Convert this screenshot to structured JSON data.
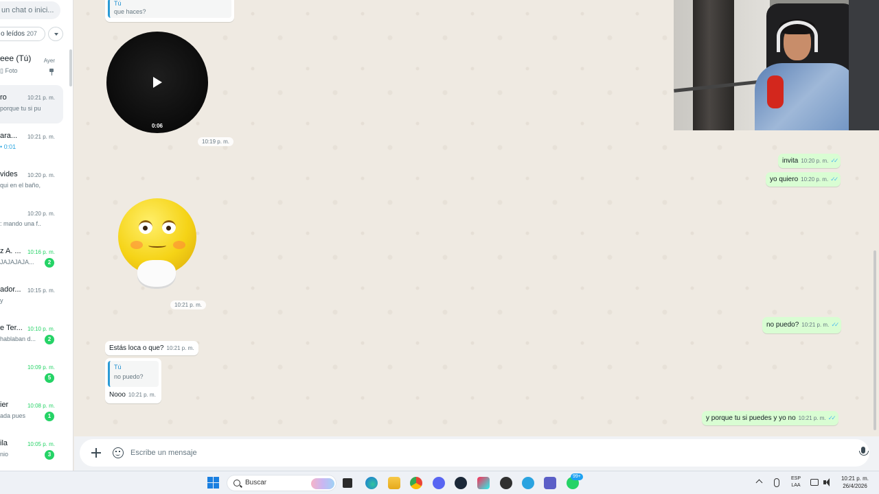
{
  "sidebar": {
    "search_text": "un chat o inici...",
    "filter_label": "o leídos",
    "filter_count": "207",
    "chats": [
      {
        "name": "eee (Tú)",
        "time": "Ayer",
        "preview": "Foto",
        "badge": "",
        "pinned": true
      },
      {
        "name": "ro",
        "time": "10:21 p. m.",
        "preview": "porque tu si pu...",
        "badge": ""
      },
      {
        "name": "ara...",
        "time": "10:21 p. m.",
        "preview": "0:01",
        "badge": ""
      },
      {
        "name": "vides",
        "time": "10:20 p. m.",
        "preview": "qui en el baño, ...",
        "badge": ""
      },
      {
        "name": "",
        "time": "10:20 p. m.",
        "preview": ": mando una f...",
        "badge": ""
      },
      {
        "name": "z A. ...",
        "time": "10:16 p. m.",
        "preview": "JAJAJAJA...",
        "badge": "2"
      },
      {
        "name": "ador...",
        "time": "10:15 p. m.",
        "preview": "y",
        "badge": ""
      },
      {
        "name": "e Ter...",
        "time": "10:10 p. m.",
        "preview": "hablaban d...",
        "badge": "2"
      },
      {
        "name": "",
        "time": "10:09 p. m.",
        "preview": "",
        "badge": "5"
      },
      {
        "name": "ier",
        "time": "10:08 p. m.",
        "preview": "ada pues",
        "badge": "1"
      },
      {
        "name": "ila",
        "time": "10:05 p. m.",
        "preview": "nio",
        "badge": "3"
      }
    ]
  },
  "chat": {
    "top_quote": {
      "name": "Tú",
      "text": "que haces?"
    },
    "video": {
      "duration": "0:06",
      "time": "10:19 p. m."
    },
    "sticker_time": "10:21 p. m.",
    "messages": [
      {
        "dir": "out",
        "text": "invita",
        "time": "10:20 p. m."
      },
      {
        "dir": "out",
        "text": "yo quiero",
        "time": "10:20 p. m."
      },
      {
        "dir": "out",
        "text": "no puedo?",
        "time": "10:21 p. m."
      },
      {
        "dir": "in",
        "text": "Estás loca o que?",
        "time": "10:21 p. m."
      },
      {
        "dir": "in",
        "quote_name": "Tú",
        "quote_text": "no puedo?",
        "text": "Nooo",
        "time": "10:21 p. m."
      },
      {
        "dir": "out",
        "text": "y porque tu si puedes y yo no",
        "time": "10:21 p. m."
      }
    ]
  },
  "compose": {
    "placeholder": "Escribe un mensaje"
  },
  "taskbar": {
    "search_label": "Buscar",
    "lang_line1": "ESP",
    "lang_line2": "LAA",
    "time": "10:21 p. m.",
    "date": "26/4/2026",
    "whatsapp_badge": "99+",
    "apps": [
      "start-icon",
      "file-explorer-icon",
      "edge-icon",
      "folder-icon",
      "chrome-icon",
      "discord-icon",
      "steam-icon",
      "tiktok-icon",
      "obs-icon",
      "telegram-icon",
      "teams-icon",
      "whatsapp-icon"
    ]
  },
  "colors": {
    "outgoing_bubble": "#d9fdd3",
    "incoming_bubble": "#ffffff",
    "badge_green": "#25d366",
    "read_ticks": "#53bdeb",
    "wallpaper": "#efeae2"
  }
}
